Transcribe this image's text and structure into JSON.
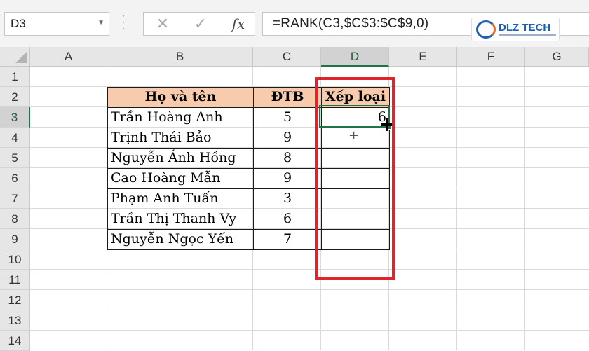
{
  "formula_bar": {
    "name_box": "D3",
    "formula": "=RANK(C3,$C$3:$C$9,0)",
    "fx_label": "fx",
    "cancel_glyph": "✕",
    "enter_glyph": "✓"
  },
  "logo": {
    "text": "DLZ TECH"
  },
  "columns": [
    "A",
    "B",
    "C",
    "D",
    "E",
    "F",
    "G"
  ],
  "rows": [
    "1",
    "2",
    "3",
    "4",
    "5",
    "6",
    "7",
    "8",
    "9",
    "10",
    "11",
    "12",
    "13",
    "14"
  ],
  "table": {
    "headers": {
      "name": "Họ và tên",
      "score": "ĐTB",
      "rank": "Xếp loại"
    },
    "rows": [
      {
        "name": "Trần Hoàng Anh",
        "score": "5",
        "rank": "6"
      },
      {
        "name": "Trịnh Thái Bảo",
        "score": "9",
        "rank": ""
      },
      {
        "name": "Nguyễn Ánh Hồng",
        "score": "8",
        "rank": ""
      },
      {
        "name": "Cao Hoàng Mẫn",
        "score": "9",
        "rank": ""
      },
      {
        "name": "Phạm Anh Tuấn",
        "score": "3",
        "rank": ""
      },
      {
        "name": "Trần Thị Thanh Vy",
        "score": "6",
        "rank": ""
      },
      {
        "name": "Nguyễn Ngọc Yến",
        "score": "7",
        "rank": ""
      }
    ]
  },
  "colors": {
    "header_fill": "#f8cbad",
    "selection": "#217346",
    "highlight": "#e0242b"
  }
}
